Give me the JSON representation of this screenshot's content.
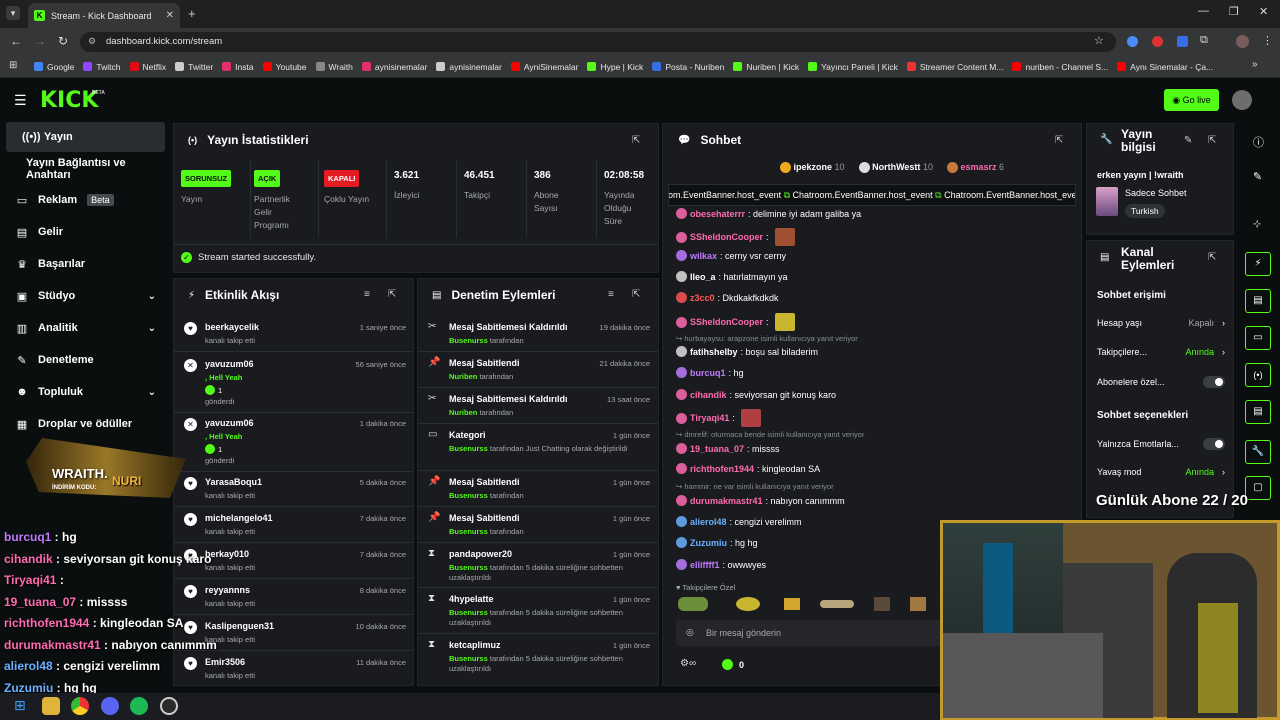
{
  "browser": {
    "tab_title": "Stream - Kick Dashboard",
    "url": "dashboard.kick.com/stream",
    "bookmarks": [
      "Google",
      "Twitch",
      "Netflix",
      "Twitter",
      "Insta",
      "Youtube",
      "Wraith",
      "aynisinemalar",
      "aynisinemalar",
      "AyniSinemalar",
      "Hype | Kick",
      "Posta - Nuriben",
      "Nuriben | Kick",
      "Yayıncı Paneli | Kick",
      "Streamer Content M...",
      "nuriben - Channel S...",
      "Aynı Sinemalar - Ça..."
    ]
  },
  "header": {
    "logo": "KICK",
    "beta": "BETA",
    "go_live": "Go live"
  },
  "sidebar": {
    "items": [
      {
        "label": "Yayın",
        "icon": "broadcast-icon"
      },
      {
        "label": "Yayın Bağlantısı ve Anahtarı",
        "icon": ""
      },
      {
        "label": "Reklam",
        "icon": "ad-icon",
        "badge": "Beta"
      },
      {
        "label": "Gelir",
        "icon": "revenue-icon"
      },
      {
        "label": "Başarılar",
        "icon": "trophy-icon"
      },
      {
        "label": "Stüdyo",
        "icon": "studio-icon"
      },
      {
        "label": "Analitik",
        "icon": "analytics-icon"
      },
      {
        "label": "Denetleme",
        "icon": "moderation-icon"
      },
      {
        "label": "Topluluk",
        "icon": "community-icon"
      },
      {
        "label": "Droplar ve ödüller",
        "icon": "drops-icon"
      }
    ]
  },
  "stats": {
    "title": "Yayın İstatistikleri",
    "cards": [
      {
        "badge": "SORUNSUZ",
        "label": "Yayın"
      },
      {
        "badge": "AÇIK",
        "label": "Partnerlik Gelir Programı"
      },
      {
        "badge": "KAPALI",
        "label": "Çoklu Yayın"
      },
      {
        "value": "3.621",
        "label": "İzleyici"
      },
      {
        "value": "46.451",
        "label": "Takipçi"
      },
      {
        "value": "386",
        "label": "Abone Sayısı"
      },
      {
        "value": "02:08:58",
        "label": "Yayında Olduğu Süre"
      }
    ],
    "status": "Stream started successfully."
  },
  "activity": {
    "title": "Etkinlik Akışı",
    "items": [
      {
        "user": "beerkaycelik",
        "sub": "kanalı takip etti",
        "time": "1 saniye önce"
      },
      {
        "user": "yavuzum06",
        "msg": ", Hell Yeah",
        "count": "1",
        "sub": "gönderdi",
        "time": "56 saniye önce"
      },
      {
        "user": "yavuzum06",
        "msg": ", Hell Yeah",
        "count": "1",
        "sub": "gönderdi",
        "time": "1 dakika önce"
      },
      {
        "user": "YarasaBoqu1",
        "sub": "kanalı takip etti",
        "time": "5 dakika önce"
      },
      {
        "user": "michelangelo41",
        "sub": "kanalı takip etti",
        "time": "7 dakika önce"
      },
      {
        "user": "berkay010",
        "sub": "kanalı takip etti",
        "time": "7 dakika önce"
      },
      {
        "user": "reyyannns",
        "sub": "kanalı takip etti",
        "time": "8 dakika önce"
      },
      {
        "user": "Kaslipenguen31",
        "sub": "kanalı takip etti",
        "time": "10 dakika önce"
      },
      {
        "user": "Emir3506",
        "sub": "kanalı takip etti",
        "time": "11 dakika önce"
      }
    ]
  },
  "moderation": {
    "title": "Denetim Eylemleri",
    "items": [
      {
        "action": "Mesaj Sabitlemesi Kaldırıldı",
        "by": "Busenurss",
        "suffix": "tarafından",
        "time": "19 dakika önce"
      },
      {
        "action": "Mesaj Sabitlendi",
        "by": "Nuriben",
        "suffix": "tarafından",
        "time": "21 dakika önce"
      },
      {
        "action": "Mesaj Sabitlemesi Kaldırıldı",
        "by": "Nuriben",
        "suffix": "tarafından",
        "time": "13 saat önce"
      },
      {
        "action": "Kategori",
        "by": "Busenurss",
        "suffix": "tarafından Just Chatting olarak değiştirildi",
        "time": "1 gün önce"
      },
      {
        "action": "Mesaj Sabitlendi",
        "by": "Busenurss",
        "suffix": "tarafından",
        "time": "1 gün önce"
      },
      {
        "action": "Mesaj Sabitlendi",
        "by": "Busenurss",
        "suffix": "tarafından",
        "time": "1 gün önce"
      },
      {
        "action": "pandapower20",
        "by": "Busenurss",
        "suffix": "tarafından 5 dakika süreliğine sohbetten uzaklaştırıldı",
        "time": "1 gün önce"
      },
      {
        "action": "4hypelatte",
        "by": "Busenurss",
        "suffix": "tarafından 5 dakika süreliğine sohbetten uzaklaştırıldı",
        "time": "1 gün önce"
      },
      {
        "action": "ketcaplimuz",
        "by": "Busenurss",
        "suffix": "tarafından 5 dakika süreliğine sohbetten uzaklaştırıldı",
        "time": "1 gün önce"
      }
    ]
  },
  "chat": {
    "title": "Sohbet",
    "top_gifters": [
      {
        "name": "ipekzone",
        "count": "10"
      },
      {
        "name": "NorthWestt",
        "count": "10"
      },
      {
        "name": "esmasrz",
        "count": "6"
      }
    ],
    "event_banner": "Chatroom.EventBanner.host_event",
    "messages": [
      {
        "user": "obesehaterrr",
        "text": ": delimine iyi adam galiba ya",
        "color": "#ff6ab0"
      },
      {
        "user": "SSheldonCooper",
        "text": ":",
        "color": "#ff6ab0"
      },
      {
        "user": "wilkax",
        "text": ": cerny vsr cerny",
        "color": "#c07bff"
      },
      {
        "user": "lleo_a",
        "text": ": hatırlatmayın ya",
        "color": "#ffffff"
      },
      {
        "user": "z3cc0",
        "text": ": Dkdkakfkdkdk",
        "color": "#ff5555"
      },
      {
        "user": "SSheldonCooper",
        "text": ":",
        "color": "#ff6ab0"
      },
      {
        "reply": "hurbayaysu: arapzone isimli kullanıcıya yanıt veriyor"
      },
      {
        "user": "fatihshelby",
        "text": ": boşu sal biladerim",
        "color": "#ffffff"
      },
      {
        "user": "burcuq1",
        "text": ": hg",
        "color": "#c07bff"
      },
      {
        "user": "cihandik",
        "text": ": seviyorsan git konuş karo",
        "color": "#ff6ab0"
      },
      {
        "user": "Tiryaqi41",
        "text": ":",
        "color": "#ff6ab0"
      },
      {
        "reply": "dmrelif: oturmaca bende isimli kullanıcıya yanıt veriyor"
      },
      {
        "user": "19_tuana_07",
        "text": ": missss",
        "color": "#ff6ab0"
      },
      {
        "user": "richthofen1944",
        "text": ": kingleodan SA",
        "color": "#ff6ab0"
      },
      {
        "reply": "hammir: ne var isimli kullanıcıya yanıt veriyor"
      },
      {
        "user": "durumakmastr41",
        "text": ": nabıyon canımmm",
        "color": "#ff6ab0"
      },
      {
        "user": "alierol48",
        "text": ": cengizi verelimm",
        "color": "#6ab0ff"
      },
      {
        "user": "Zuzumiu",
        "text": ": hg hg",
        "color": "#6ab0ff"
      },
      {
        "user": "elliffff1",
        "text": ": owwwyes",
        "color": "#c07bff"
      }
    ],
    "followers_only": "Takipçilere Özel",
    "input_placeholder": "Bir mesaj gönderin",
    "points": "0"
  },
  "stream_info": {
    "title": "Yayın bilgisi",
    "stream_title": "erken yayın | !wraith",
    "category": "Sadece Sohbet",
    "tag": "Turkish"
  },
  "channel_actions": {
    "title": "Kanal Eylemleri",
    "section1": "Sohbet erişimi",
    "age": {
      "label": "Hesap yaşı",
      "value": "Kapalı"
    },
    "followers": {
      "label": "Takipçilere...",
      "value": "Anında"
    },
    "subs_only": "Abonelere özel...",
    "section2": "Sohbet seçenekleri",
    "emotes_only": "Yalnızca Emotlarla...",
    "slow": {
      "label": "Yavaş mod",
      "value": "Anında"
    }
  },
  "overlay": {
    "sub_goal": "Günlük Abone 22 / 20",
    "promo_brand": "WRAITH.",
    "promo_code_label": "İNDİRİM KODU:",
    "promo_code": "NURI",
    "chat": [
      {
        "user": "burcuq1",
        "text": " : hg",
        "color": "#c07bff"
      },
      {
        "user": "cihandik",
        "text": " : seviyorsan git konuş karo",
        "color": "#ff6ab0"
      },
      {
        "user": "Tiryaqi41",
        "text": " :",
        "color": "#ff6ab0"
      },
      {
        "user": "19_tuana_07",
        "text": " : missss",
        "color": "#ff6ab0"
      },
      {
        "user": "richthofen1944",
        "text": " : kingleodan SA",
        "color": "#ff6ab0"
      },
      {
        "user": "durumakmastr41",
        "text": " : nabıyon canımmm",
        "color": "#ff6ab0"
      },
      {
        "user": "alierol48",
        "text": " : cengizi verelimm",
        "color": "#6ab0ff"
      },
      {
        "user": "Zuzumiu",
        "text": " : hg hg",
        "color": "#6ab0ff"
      }
    ]
  },
  "colors": {
    "accent": "#53fc18",
    "panel": "#191b1f",
    "bg": "#0b0e0f"
  }
}
